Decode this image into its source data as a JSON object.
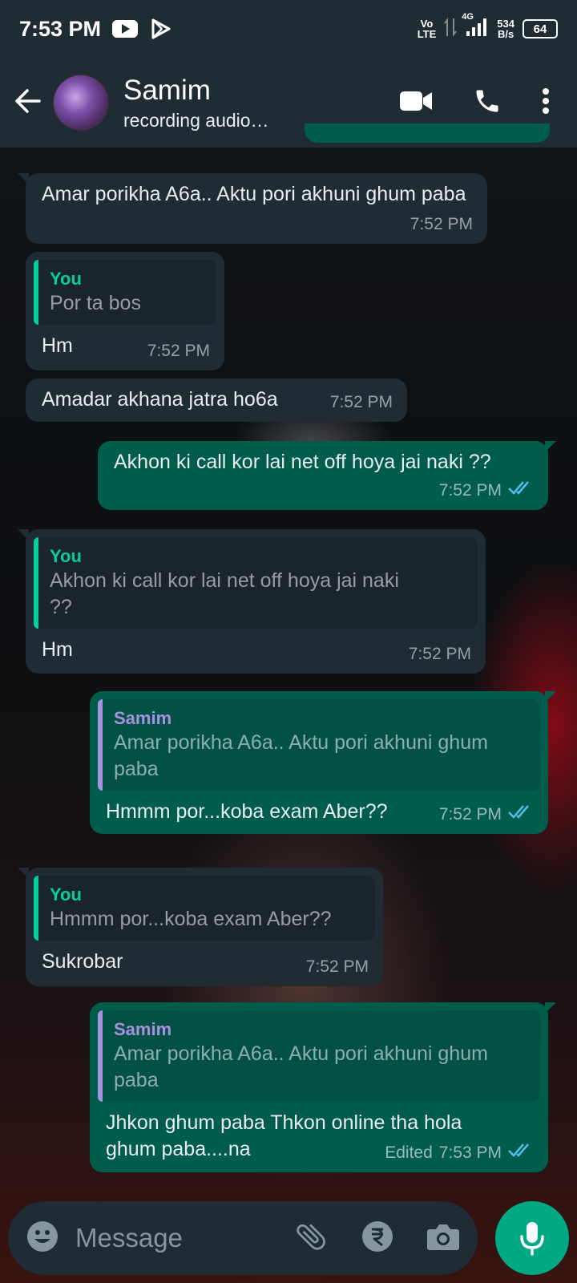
{
  "status_bar": {
    "time": "7:53 PM",
    "net_top": "Vo",
    "net_bottom": "LTE",
    "signal_gen": "4G",
    "speed_value": "534",
    "speed_unit": "B/s",
    "battery": "64"
  },
  "header": {
    "name": "Samim",
    "status": "recording audio…"
  },
  "messages": [
    {
      "dir": "in",
      "text": "Amar porikha A6a.. Aktu pori akhuni ghum paba",
      "time": "7:52 PM"
    },
    {
      "dir": "in",
      "quote_author": "You",
      "quote_text": "Por ta bos",
      "text": "Hm",
      "time": "7:52 PM"
    },
    {
      "dir": "in",
      "text": "Amadar akhana jatra ho6a",
      "time": "7:52 PM"
    },
    {
      "dir": "out",
      "text": "Akhon ki call kor lai net off hoya jai naki ??",
      "time": "7:52 PM"
    },
    {
      "dir": "in",
      "quote_author": "You",
      "quote_text": "Akhon ki call kor lai net off hoya jai naki ??",
      "text": "Hm",
      "time": "7:52 PM"
    },
    {
      "dir": "out",
      "quote_author": "Samim",
      "quote_text": "Amar porikha A6a.. Aktu pori akhuni ghum paba",
      "text": "Hmmm por...koba exam Aber??",
      "time": "7:52 PM"
    },
    {
      "dir": "in",
      "quote_author": "You",
      "quote_text": "Hmmm por...koba exam Aber??",
      "text": "Sukrobar",
      "time": "7:52 PM"
    },
    {
      "dir": "out",
      "quote_author": "Samim",
      "quote_text": "Amar porikha A6a.. Aktu pori akhuni ghum paba",
      "text": "Jhkon ghum paba Thkon online tha hola ghum paba....na",
      "edited": "Edited",
      "time": "7:53 PM"
    }
  ],
  "composer": {
    "placeholder": "Message"
  },
  "colors": {
    "header_bg": "#1f2c34",
    "incoming_bubble": "#1f2c34",
    "outgoing_bubble": "#005c4b",
    "accent": "#00a884",
    "read_ticks": "#53bdeb"
  }
}
